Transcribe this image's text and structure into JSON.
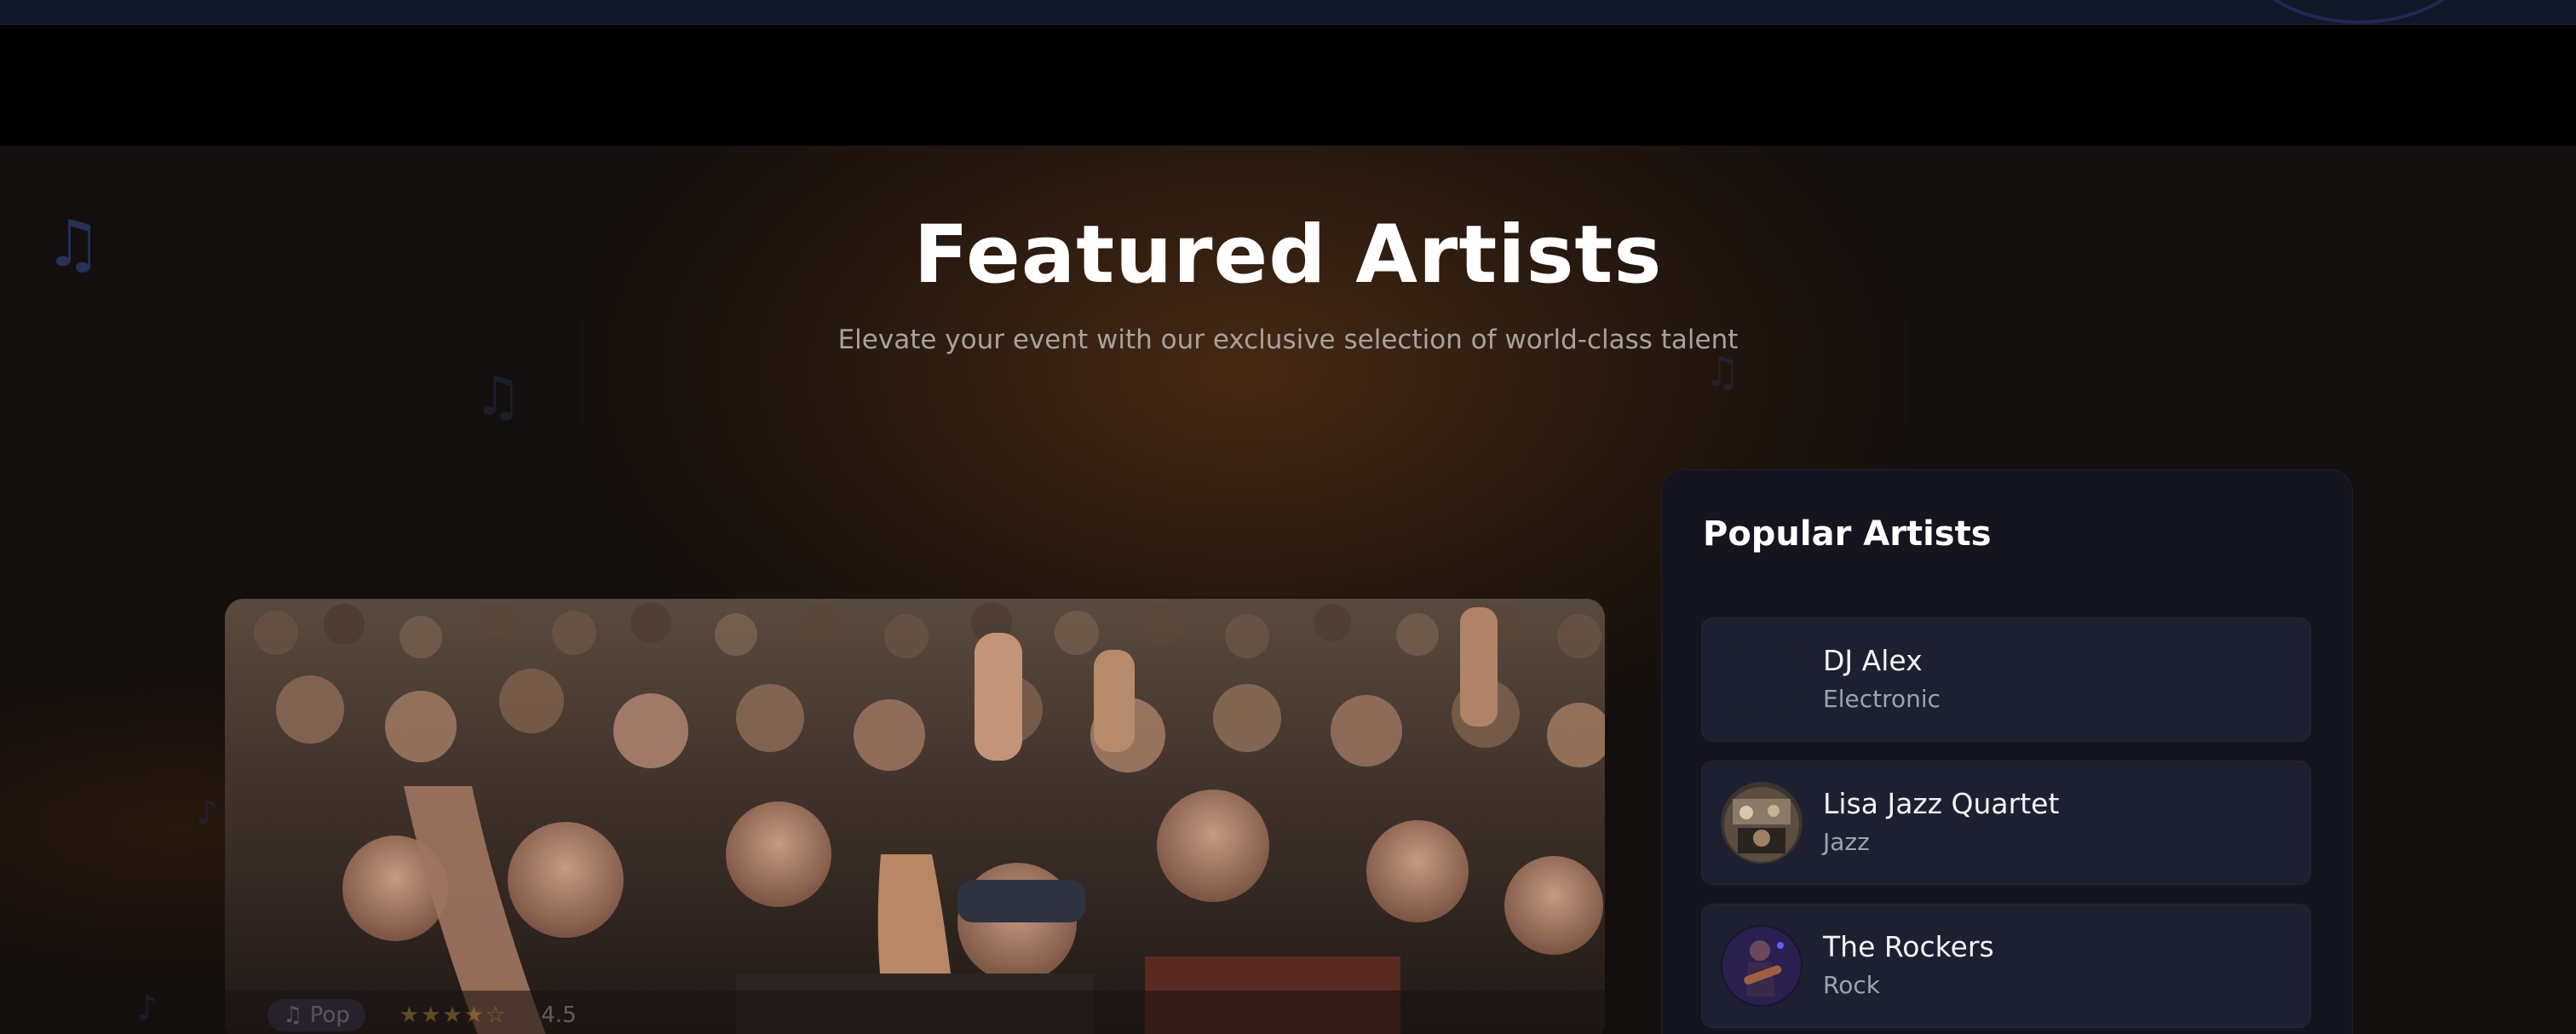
{
  "header": {
    "title": "Featured Artists",
    "subtitle": "Elevate your event with our exclusive selection of world-class talent"
  },
  "background_icons": [
    "music-note-icon",
    "music-note-icon",
    "music-note-icon",
    "music-note-icon",
    "music-note-icon"
  ],
  "featured": {
    "image": "concert-crowd-photo",
    "genre_chip": "♫ Pop",
    "rating": "4.5",
    "stars": "★★★★☆"
  },
  "popular": {
    "title": "Popular Artists",
    "items": [
      {
        "name": "DJ Alex",
        "genre": "Electronic",
        "avatar": "none"
      },
      {
        "name": "Lisa Jazz Quartet",
        "genre": "Jazz",
        "avatar": "jazz-stage-photo"
      },
      {
        "name": "The Rockers",
        "genre": "Rock",
        "avatar": "guitarist-photo"
      }
    ]
  },
  "colors": {
    "background": "#130f0e",
    "panel": "#15151f",
    "card": "#1d2030",
    "accent_ring": "#1e2a55"
  }
}
